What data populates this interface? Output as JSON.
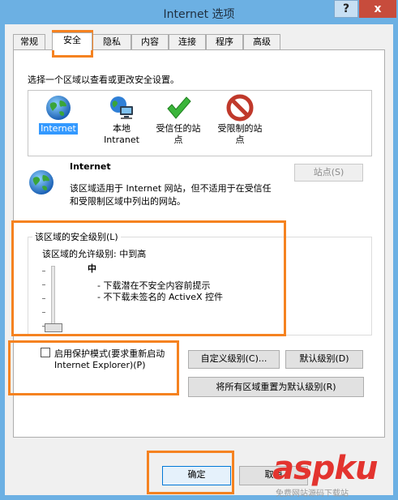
{
  "window": {
    "title": "Internet 选项",
    "help_glyph": "?",
    "close_glyph": "x"
  },
  "tabs": [
    {
      "label": "常规"
    },
    {
      "label": "安全",
      "active": true
    },
    {
      "label": "隐私"
    },
    {
      "label": "内容"
    },
    {
      "label": "连接"
    },
    {
      "label": "程序"
    },
    {
      "label": "高级"
    }
  ],
  "security": {
    "select_zone_prompt": "选择一个区域以查看或更改安全设置。",
    "zones": [
      {
        "line1": "Internet",
        "line2": "",
        "icon": "globe-icon",
        "selected": true
      },
      {
        "line1": "本地",
        "line2": "Intranet",
        "icon": "local-intranet-icon",
        "selected": false
      },
      {
        "line1": "受信任的站",
        "line2": "点",
        "icon": "trusted-check-icon",
        "selected": false
      },
      {
        "line1": "受限制的站",
        "line2": "点",
        "icon": "restricted-icon",
        "selected": false
      }
    ],
    "zone_detail": {
      "name": "Internet",
      "desc_line1": "该区域适用于 Internet 网站，但不适用于在受信任",
      "desc_line2": "和受限制区域中列出的网站。",
      "sites_button": "站点(S)"
    },
    "level_group": {
      "legend": "该区域的安全级别(L)",
      "allowed_levels": "该区域的允许级别: 中到高",
      "level_name": "中",
      "bullet1": "- 下载潜在不安全内容前提示",
      "bullet2": "- 不下载未签名的 ActiveX 控件",
      "slider_level_index": 0,
      "slider_level_count": 5
    },
    "protected_mode": {
      "label_line1": "启用保护模式(要求重新启动",
      "label_line2": "Internet Explorer)(P)",
      "checked": false
    },
    "custom_level_button": "自定义级别(C)...",
    "default_level_button": "默认级别(D)",
    "reset_all_button": "将所有区域重置为默认级别(R)"
  },
  "footer": {
    "ok_button": "确定",
    "cancel_button": "取消"
  },
  "watermark": {
    "logo_text": "aspku",
    "sub_text": "免费网站源码下载站"
  },
  "colors": {
    "titlebar": "#6cb0e3",
    "close_button": "#c74c3c",
    "highlight": "#f58220",
    "selection": "#3399ff",
    "watermark": "#e3342f"
  }
}
